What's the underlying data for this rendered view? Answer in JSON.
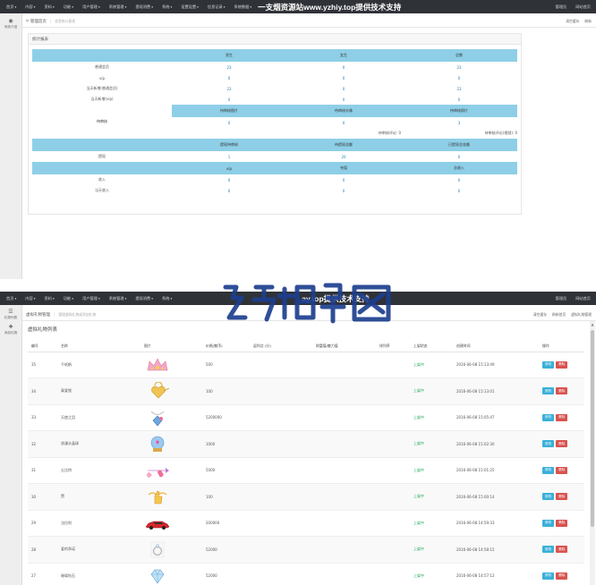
{
  "top_nav": {
    "menus": [
      "首页",
      "内容",
      "资料",
      "功能",
      "用户管理",
      "系统管理",
      "提现消费",
      "系统",
      "设置设置",
      "信息记录",
      "系统数据"
    ],
    "watermark": "一支烟资源站www.yzhiy.top提供技术支持",
    "right": [
      "管理员",
      "网站首页"
    ]
  },
  "sidebar1": {
    "items": [
      {
        "icon": "eye-icon",
        "label": "系统介绍"
      }
    ]
  },
  "breadcrumb1": {
    "home_label": "管理首页",
    "hint": "信息统计报表",
    "right": [
      "清空缓存",
      "刷新"
    ]
  },
  "stats_panel": {
    "title": "统计报表",
    "members": {
      "headers": [
        "男生",
        "女生",
        "总数"
      ],
      "rows": [
        {
          "label": "普通会员",
          "values": [
            "23",
            "0",
            "23"
          ]
        },
        {
          "label": "vip",
          "values": [
            "0",
            "0",
            "0"
          ]
        },
        {
          "label": "当天新增(普通会员)",
          "values": [
            "23",
            "0",
            "23"
          ]
        },
        {
          "label": "当天新增(vip)",
          "values": [
            "0",
            "0",
            "0"
          ]
        }
      ]
    },
    "pending": {
      "label": "待审核",
      "headers": [
        "待审核图片",
        "待审核头像",
        "待审核照片"
      ],
      "values": [
        "0",
        "0",
        "3"
      ],
      "extra": [
        "待审核评论: 0",
        "待审核评论(视频): 0"
      ]
    },
    "withdraw": {
      "label": "提现",
      "headers": [
        "提现待审核",
        "待提现总额",
        "已提现总金额"
      ],
      "values": [
        "1",
        "20",
        "0"
      ]
    },
    "income": {
      "headers": [
        "vip",
        "充值",
        "总收入"
      ],
      "rows": [
        {
          "label": "收入",
          "values": [
            "0",
            "0",
            "0"
          ]
        },
        {
          "label": "当天收入",
          "values": [
            "0",
            "0",
            "0"
          ]
        }
      ]
    }
  },
  "second_shot": {
    "watermark_partial": "ay.top提供技术支持",
    "sidebar": {
      "items": [
        {
          "icon": "list-icon",
          "label": "礼物列表"
        },
        {
          "icon": "plus-icon",
          "label": "添加礼物"
        }
      ]
    },
    "breadcrumb": {
      "home_label": "虚拟礼物管理",
      "hint": "管理虚拟礼物或添加礼物",
      "right": [
        "清空缓存",
        "刷新首页",
        "虚拟礼物管理"
      ]
    },
    "panel_title": "虚拟礼物列表",
    "table": {
      "headers": [
        "编号",
        "名称",
        "图片",
        "价格(魅币)",
        "返利点 (分)",
        "财富值/魅力值",
        "排列序",
        "上架状态",
        "创建时间",
        "操作"
      ],
      "edit_label": "修改",
      "delete_label": "删除",
      "rows": [
        {
          "id": "35",
          "name": "千纸鹤",
          "icon": "crown-gift-icon",
          "price": "500",
          "status": "上架中",
          "created": "2016-06-08 15:13:49"
        },
        {
          "id": "34",
          "name": "真爱锁",
          "icon": "heart-lock-gift-icon",
          "price": "100",
          "status": "上架中",
          "created": "2016-06-08 15:13:01"
        },
        {
          "id": "33",
          "name": "天使之泪",
          "icon": "pendant-gift-icon",
          "price": "5200000",
          "status": "上架中",
          "created": "2016-06-08 15:05:47"
        },
        {
          "id": "32",
          "name": "浪漫水晶球",
          "icon": "crystal-ball-gift-icon",
          "price": "1000",
          "status": "上架中",
          "created": "2016-06-08 15:02:30"
        },
        {
          "id": "31",
          "name": "丘比特",
          "icon": "cupid-gift-icon",
          "price": "5000",
          "status": "上架中",
          "created": "2016-06-08 15:01:25"
        },
        {
          "id": "30",
          "name": "赞",
          "icon": "thumbs-up-gift-icon",
          "price": "100",
          "status": "上架中",
          "created": "2016-06-08 15:00:14"
        },
        {
          "id": "29",
          "name": "法拉利",
          "icon": "sports-car-gift-icon",
          "price": "200000",
          "status": "上架中",
          "created": "2016-06-08 14:59:33"
        },
        {
          "id": "28",
          "name": "爱的承诺",
          "icon": "ring-gift-icon",
          "price": "52000",
          "status": "上架中",
          "created": "2016-06-08 14:58:15"
        },
        {
          "id": "27",
          "name": "璀璨钻石",
          "icon": "diamond-gift-icon",
          "price": "52000",
          "status": "上架中",
          "created": "2016-06-08 14:57:12"
        }
      ]
    }
  },
  "colors": {
    "nav_bg": "#2f3237",
    "header_cell": "#8ecfe7",
    "value_blue": "#2a7fb8",
    "status_green": "#1aa554",
    "edit_btn": "#3bb0d8",
    "delete_btn": "#d9534f"
  }
}
